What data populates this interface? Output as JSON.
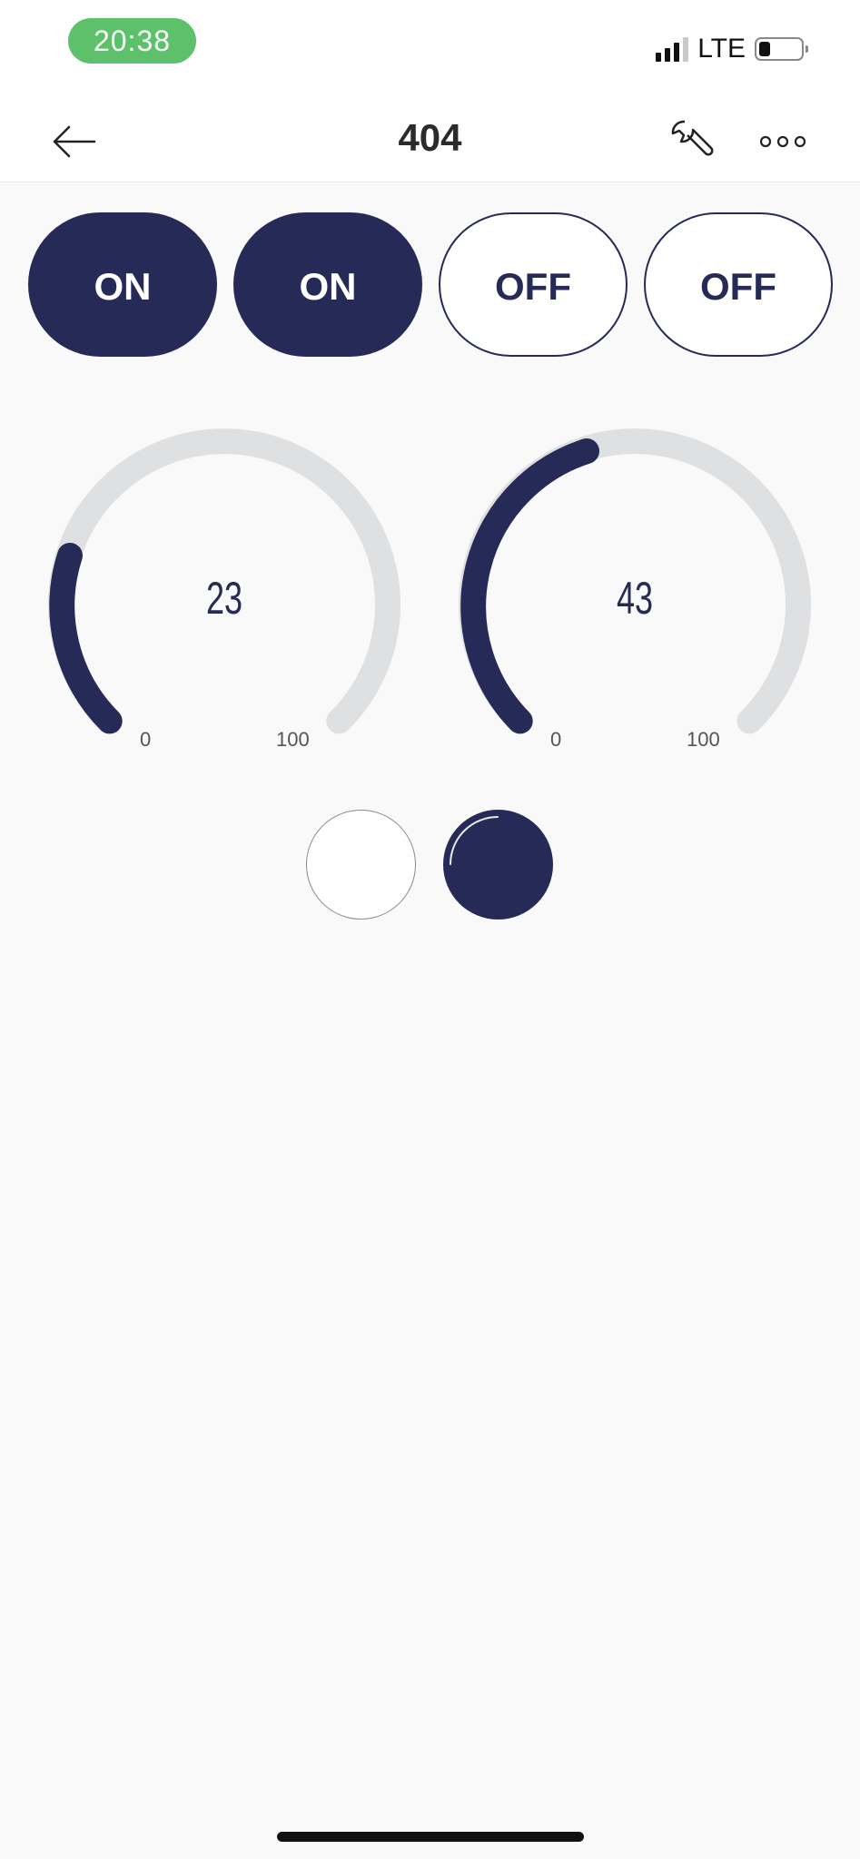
{
  "status_bar": {
    "time": "20:38",
    "network": "LTE",
    "battery_icon": "battery-icon",
    "signal_icon": "signal-icon"
  },
  "header": {
    "title": "404",
    "back_icon": "arrow-left-icon",
    "settings_icon": "wrench-icon",
    "more_icon": "more-dots-icon"
  },
  "switches": [
    {
      "label": "ON",
      "state": "on"
    },
    {
      "label": "ON",
      "state": "on"
    },
    {
      "label": "OFF",
      "state": "off"
    },
    {
      "label": "OFF",
      "state": "off"
    }
  ],
  "gauges": [
    {
      "value": "23",
      "min": "0",
      "max": "100"
    },
    {
      "value": "43",
      "min": "0",
      "max": "100"
    }
  ],
  "leds": [
    {
      "state": "off"
    },
    {
      "state": "on"
    }
  ],
  "colors": {
    "accent": "#262a57",
    "time_pill": "#5cc16a",
    "gauge_track": "#dfe0e2"
  }
}
